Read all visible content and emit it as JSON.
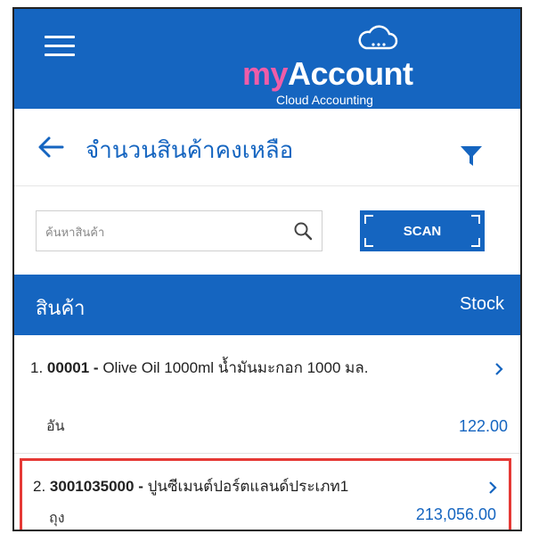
{
  "header": {
    "brand_prefix": "my",
    "brand_main": "Account",
    "brand_sub": "Cloud Accounting",
    "icons": {
      "menu": "hamburger-icon",
      "logo": "cloud-icon"
    }
  },
  "titlebar": {
    "title": "จำนวนสินค้าคงเหลือ",
    "icons": {
      "back": "arrow-left-icon",
      "filter": "filter-icon"
    }
  },
  "search": {
    "placeholder": "ค้นหาสินค้า",
    "value": "",
    "scan_label": "SCAN"
  },
  "list": {
    "columns": {
      "product": "สินค้า",
      "stock": "Stock"
    },
    "items": [
      {
        "index": "1.",
        "code": "00001",
        "separator": " - ",
        "name": "Olive Oil 1000ml น้ำมันมะกอก 1000 มล.",
        "unit": "อัน",
        "qty": "122.00"
      },
      {
        "index": "2.",
        "code": "3001035000",
        "separator": " - ",
        "name": "ปูนซีเมนต์ปอร์ตแลนด์ประเภท1",
        "unit": "ถุง",
        "qty": "213,056.00"
      }
    ]
  },
  "colors": {
    "primary": "#1565c0",
    "brand_accent": "#ef5da8",
    "highlight_border": "#e53935"
  }
}
